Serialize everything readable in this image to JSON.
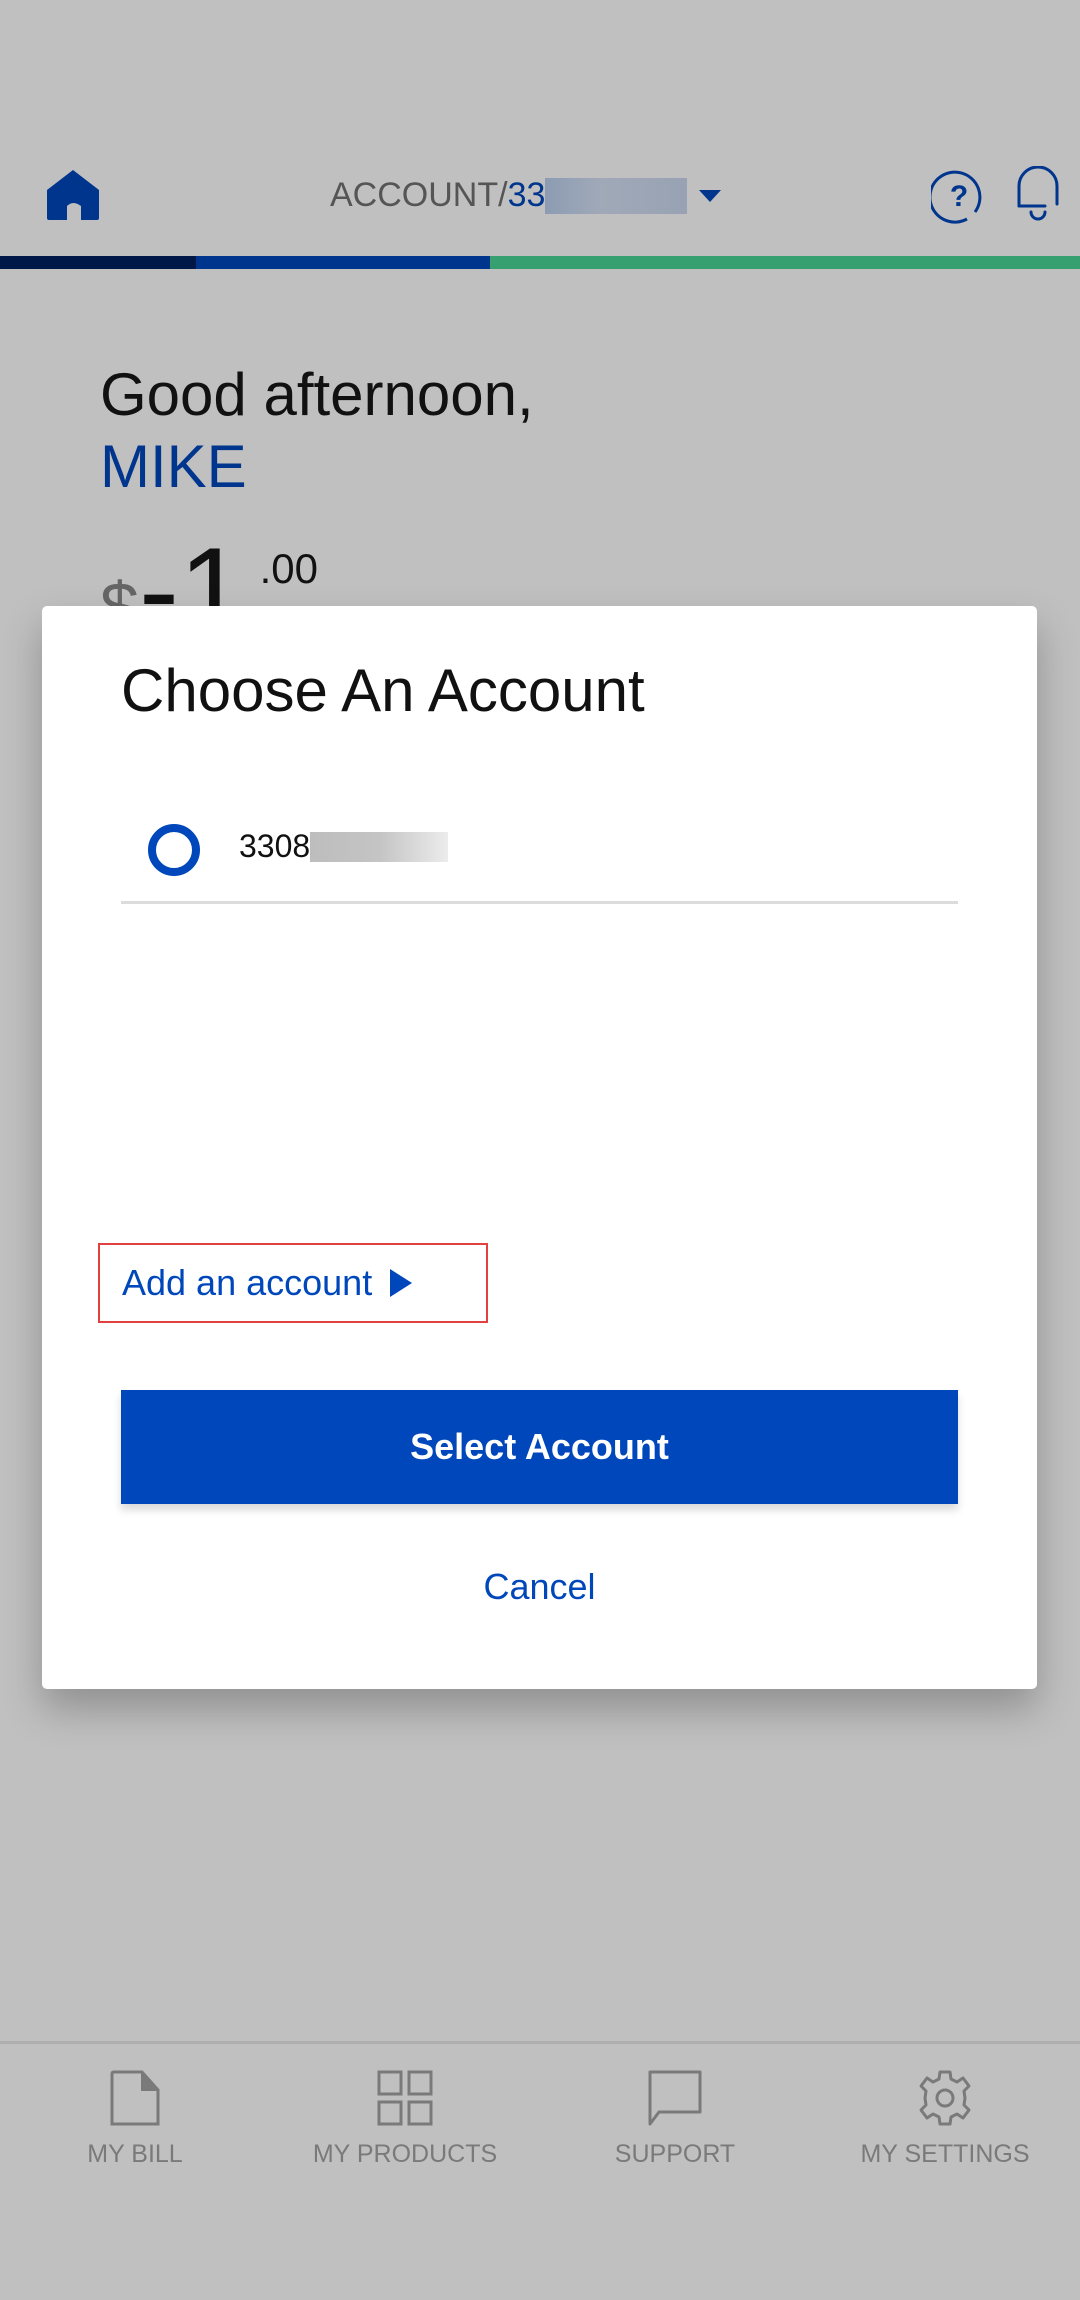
{
  "header": {
    "account_prefix": "ACCOUNT/",
    "account_number_visible": "33",
    "icons": [
      "home-icon",
      "help-icon",
      "bell-icon",
      "dropdown-caret-icon"
    ]
  },
  "greeting": {
    "salutation": "Good afternoon,",
    "name": "MIKE"
  },
  "balance": {
    "currency": "$",
    "whole": "-1",
    "cents": ".00"
  },
  "modal": {
    "title": "Choose An Account",
    "accounts": [
      {
        "number_visible": "3308",
        "selected": false
      }
    ],
    "add_account_label": "Add an account",
    "select_button_label": "Select Account",
    "cancel_label": "Cancel"
  },
  "bottom_nav": {
    "items": [
      {
        "label": "MY BILL",
        "icon": "bill-icon"
      },
      {
        "label": "MY PRODUCTS",
        "icon": "products-grid-icon"
      },
      {
        "label": "SUPPORT",
        "icon": "chat-bubble-icon"
      },
      {
        "label": "MY SETTINGS",
        "icon": "gear-icon"
      }
    ]
  },
  "colors": {
    "brand_blue": "#0047bb",
    "dark_blue": "#00358e",
    "navy": "#001848",
    "green": "#37a070",
    "highlight_red": "#e34040"
  }
}
